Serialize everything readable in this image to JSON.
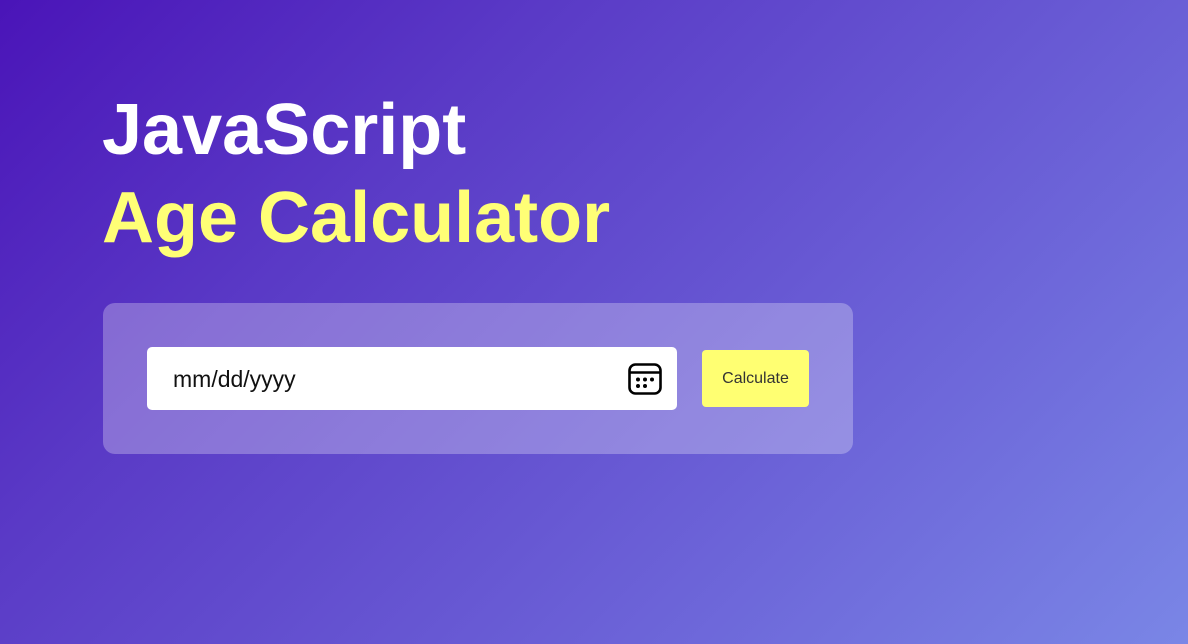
{
  "heading": {
    "line1": "JavaScript",
    "line2": "Age Calculator"
  },
  "form": {
    "date_placeholder": "mm/dd/yyyy",
    "calendar_icon": "calendar-icon",
    "calculate_label": "Calculate"
  },
  "colors": {
    "accent": "#ffff76",
    "title": "#ffffff",
    "gradient_start": "#4a14b8",
    "gradient_end": "#7a86e6"
  }
}
